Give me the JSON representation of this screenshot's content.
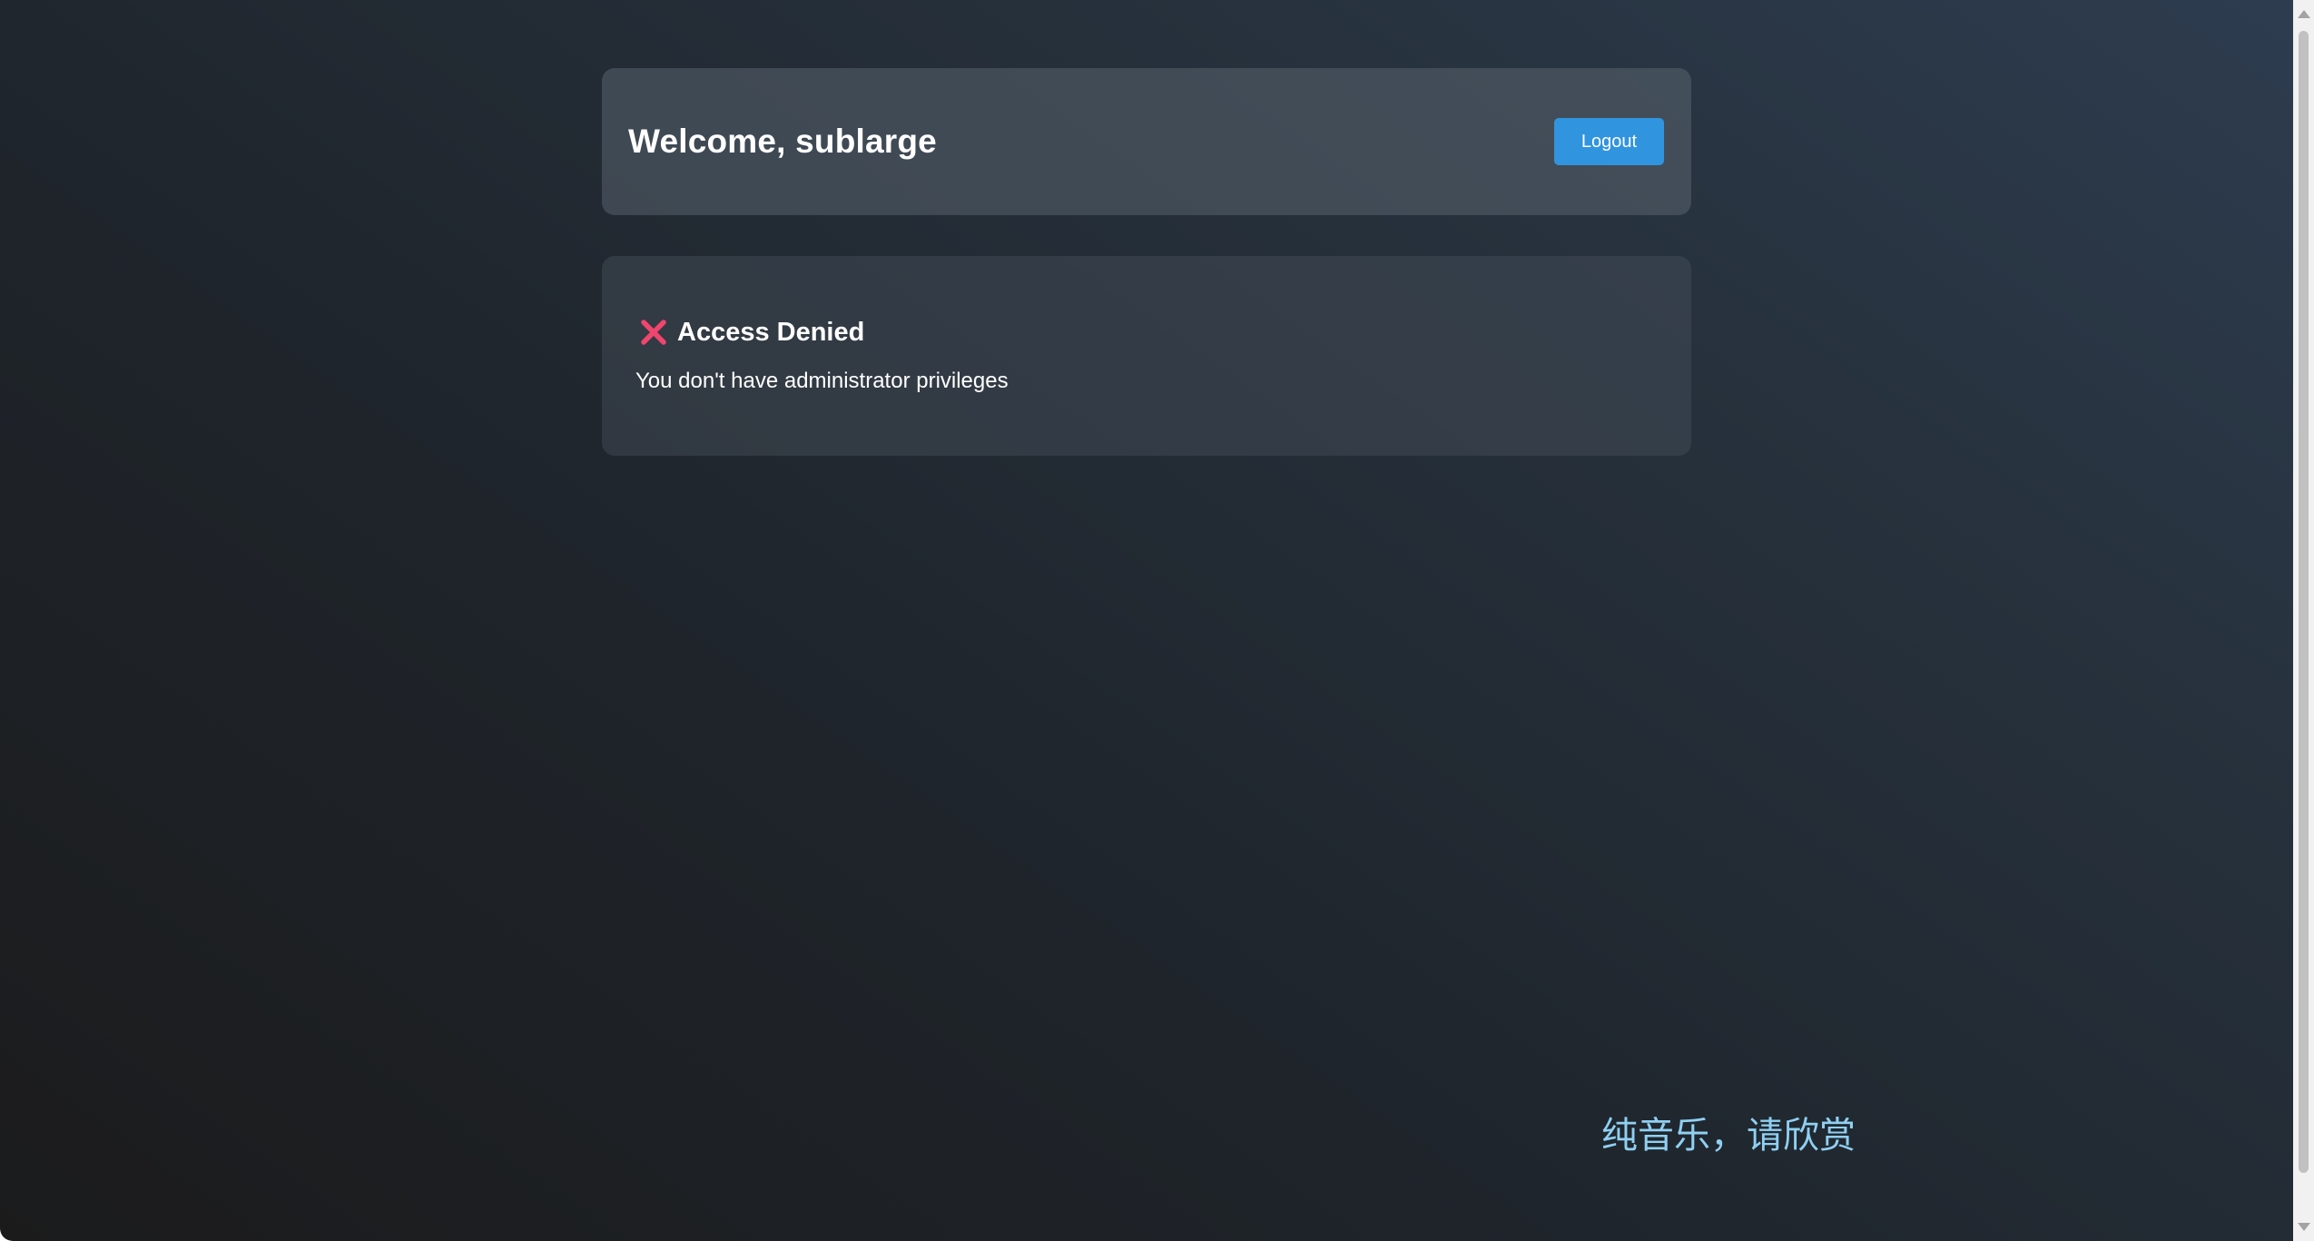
{
  "header": {
    "welcome_text": "Welcome, sublarge",
    "logout_label": "Logout"
  },
  "access": {
    "icon": "cross-mark-icon",
    "title": "Access Denied",
    "message": "You don't have administrator privileges"
  },
  "footer_note": "纯音乐，请欣赏",
  "colors": {
    "accent": "#3194de",
    "error_icon": "#f0456e",
    "note_text": "#8fd0f2"
  }
}
